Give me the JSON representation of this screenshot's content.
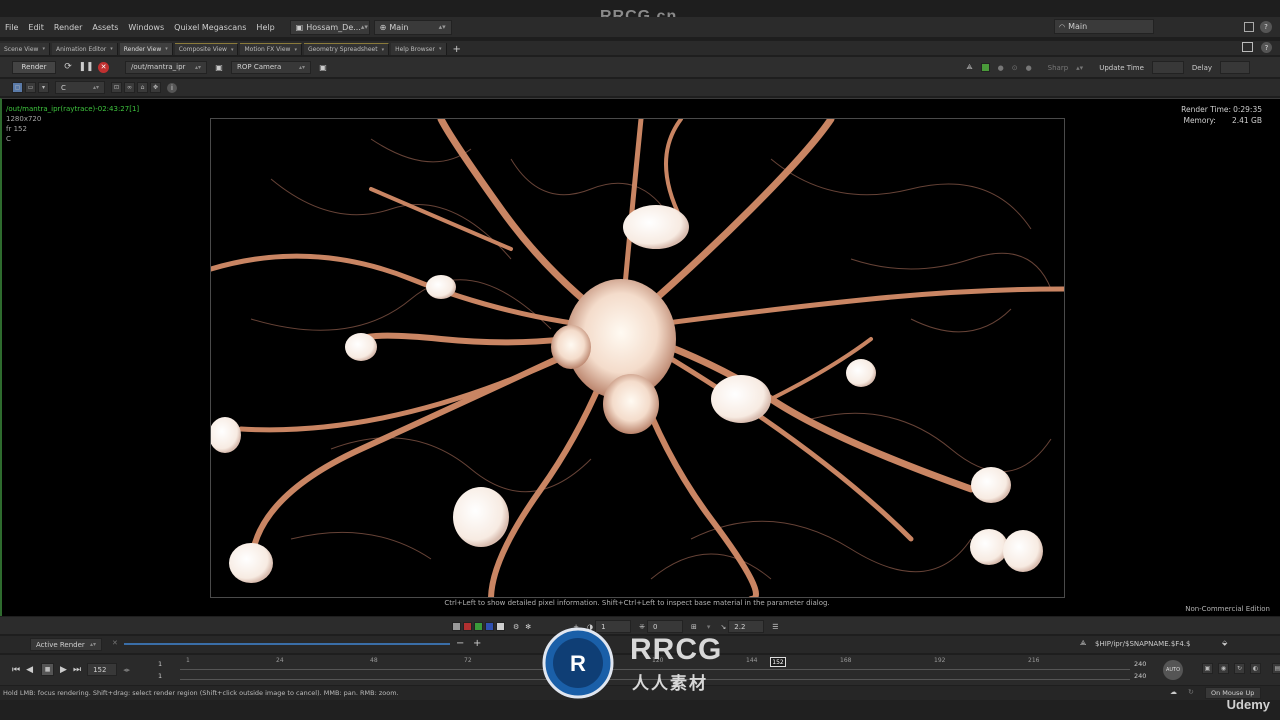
{
  "watermark": {
    "top": "RRCG.cn",
    "brand": "RRCG",
    "brand_cn": "人人素材"
  },
  "menu": {
    "items": [
      "File",
      "Edit",
      "Render",
      "Assets",
      "Windows",
      "Quixel Megascans",
      "Help"
    ],
    "desktop": "Hossam_De...",
    "desk2": "Main",
    "right_main": "Main"
  },
  "tabs": [
    {
      "label": "Scene View"
    },
    {
      "label": "Animation Editor"
    },
    {
      "label": "Render View"
    },
    {
      "label": "Composite View"
    },
    {
      "label": "Motion FX View"
    },
    {
      "label": "Geometry Spreadsheet"
    },
    {
      "label": "Help Browser"
    }
  ],
  "toolbar": {
    "render_label": "Render",
    "rop_path": "/out/mantra_ipr",
    "camera": "ROP Camera",
    "sharp": "Sharp",
    "update_time": "Update Time",
    "delay": "Delay"
  },
  "toolbar2": {
    "channel": "C"
  },
  "viewport": {
    "path": "/out/mantra_ipr(raytrace)-02:43:27[1]",
    "resolution": "1280x720",
    "frame": "fr 152",
    "channel": "C",
    "render_time_label": "Render Time:",
    "render_time": "0:29:35",
    "memory_label": "Memory:",
    "memory": "2.41 GB",
    "hint": "Ctrl+Left to show detailed pixel information. Shift+Ctrl+Left to inspect base material in the parameter dialog.",
    "edition": "Non-Commercial Edition"
  },
  "display": {
    "field1": "1",
    "field2": "0",
    "gamma": "2.2"
  },
  "snapshot": {
    "active_render": "Active Render",
    "path": "$HIP/ipr/$SNAPNAME.$F4.$"
  },
  "timeline": {
    "current_frame": "152",
    "start1": "1",
    "start2": "1",
    "ticks": [
      "1",
      "24",
      "48",
      "72",
      "96",
      "120",
      "144",
      "168",
      "192",
      "216"
    ],
    "end1": "240",
    "end2": "240",
    "playhead": "152",
    "auto": "AUTO"
  },
  "status": {
    "text": "Hold LMB: focus rendering. Shift+drag: select render region (Shift+click outside image to cancel). MMB: pan. RMB: zoom.",
    "update_mode": "On Mouse Up",
    "udemy": "Udemy"
  },
  "colors": {
    "accent_green": "#3ec43e",
    "bg": "#1e1e1e",
    "stop": "#c03030"
  }
}
